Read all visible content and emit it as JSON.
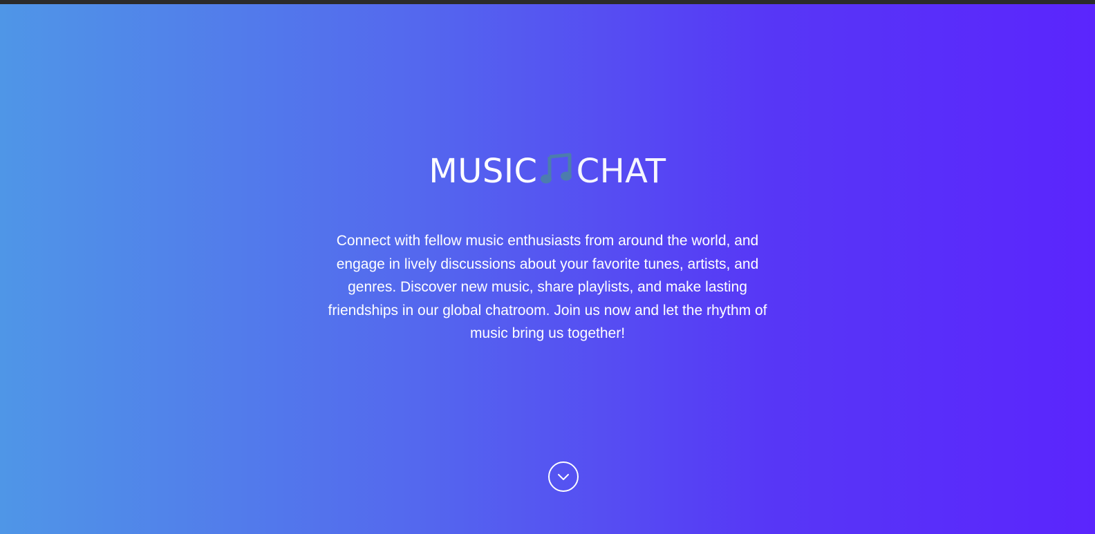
{
  "hero": {
    "title_bold": "MUSIC",
    "title_light": "CHAT",
    "icon": "music-note-icon",
    "description": "Connect with fellow music enthusiasts from around the world, and engage in lively discussions about your favorite tunes, artists, and genres. Discover new music, share playlists, and make lasting friendships in our global chatroom. Join us now and let the rhythm of music bring us together!",
    "scroll_icon": "chevron-down-icon"
  },
  "colors": {
    "gradient_start": "#4f96e7",
    "gradient_end": "#5b25fd",
    "note_icon": "#4c7dad",
    "top_bar": "#2b2b2b"
  }
}
